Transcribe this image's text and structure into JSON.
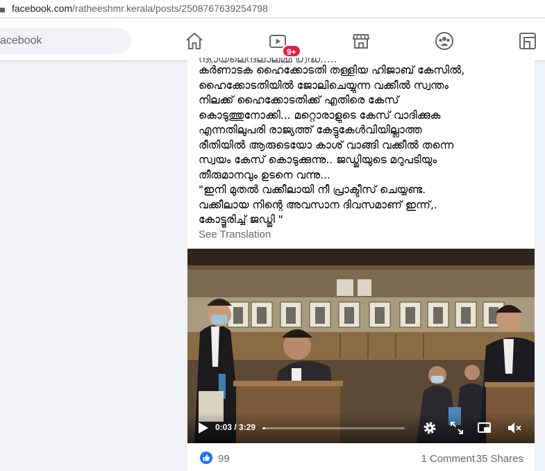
{
  "browser": {
    "url_host": "facebook.com",
    "url_path": "/ratheeshmr.kerala/posts/2508767639254798"
  },
  "nav": {
    "search_placeholder": "acebook",
    "watch_badge": "9+",
    "icons": [
      "home-icon",
      "watch-icon",
      "marketplace-icon",
      "groups-icon",
      "gaming-icon"
    ]
  },
  "post": {
    "text_lines": [
      "ന്ദ്യായലെന്ദലാലമ്മ ഗ്രദ്ധ.....",
      "കർണാടക ഹൈക്കോടതി തള്ളിയ ഹിജാബ് കേസിൽ,",
      "ഹൈക്കോടതിയിൽ ജോലിചെയ്യുന്ന വക്കീൽ സ്വന്തം",
      "നിലക്ക്  ഹൈക്കോടതിക്ക് എതിരെ കേസ്",
      "കൊടുത്തുനോക്കി... മറ്റൊരാളുടെ കേസ് വാദിക്കുക",
      "എന്നതിലുപരി രാജ്യത്ത് കേട്ടുകേൾവിയില്ലാത്ത",
      "രീതിയിൽ ആരുടെയോ കാശ് വാങ്ങി വക്കീൽ തന്നെ",
      "സ്വയം കേസ് കൊടുക്കുന്നു.. ജഡ്ജിയുടെ മറുപടിയും",
      "തീരുമാനവും ഉടനെ വന്നു...",
      "\"ഇനി മുതൽ വക്കീലായി നീ പ്രാക്ടീസ് ചെയ്യണ്ട.",
      "വക്കീലായ നിന്റെ അവസാന ദിവസമാണ് ഇന്ന്,.",
      "കോട്ടൂരിച്ച് ജഡ്ജി \""
    ],
    "see_translation": "See Translation",
    "video": {
      "time_display": "0:03 / 3:29",
      "progress_fraction": 0.0144
    },
    "reactions": {
      "like_count": "99",
      "comments": "1 Comment",
      "shares": "35 Shares"
    }
  },
  "colors": {
    "brand_blue": "#1877f2",
    "badge_red": "#e41e3f",
    "muted_text": "#65676b"
  }
}
